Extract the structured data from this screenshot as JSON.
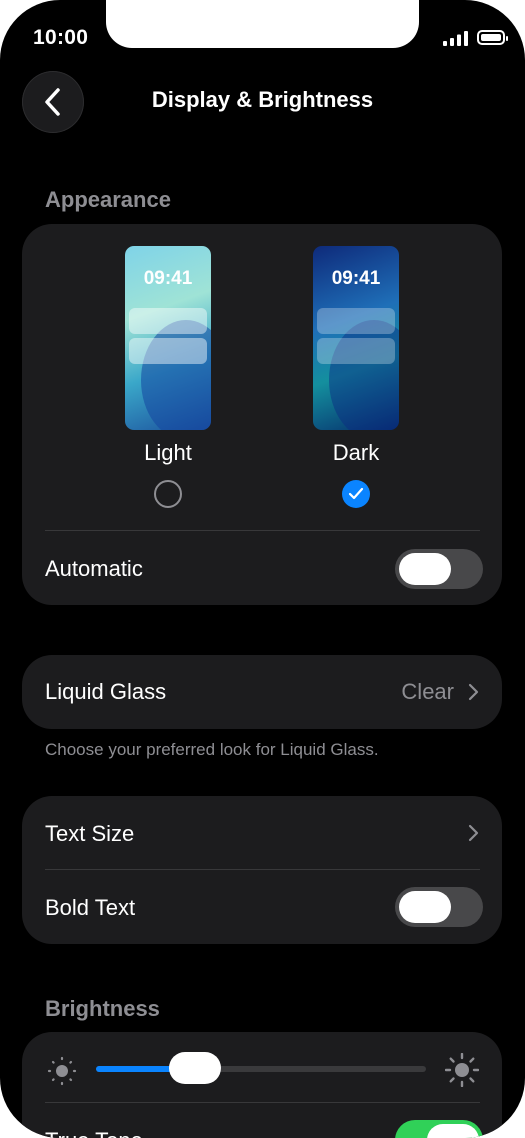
{
  "status_bar": {
    "time": "10:00"
  },
  "nav": {
    "title": "Display & Brightness"
  },
  "appearance": {
    "header": "Appearance",
    "options": [
      {
        "label": "Light",
        "preview_time": "09:41",
        "selected": false
      },
      {
        "label": "Dark",
        "preview_time": "09:41",
        "selected": true
      }
    ],
    "automatic_label": "Automatic",
    "automatic_on": false
  },
  "liquid_glass": {
    "label": "Liquid Glass",
    "value": "Clear",
    "footnote": "Choose your preferred look for Liquid Glass."
  },
  "text": {
    "text_size_label": "Text Size",
    "bold_text_label": "Bold Text",
    "bold_text_on": false
  },
  "brightness": {
    "header": "Brightness",
    "level": 0.3,
    "true_tone_label": "True Tone",
    "true_tone_on": true
  },
  "colors": {
    "accent": "#0a84ff",
    "toggle_on": "#30d158",
    "secondary_text": "#8e8e93"
  }
}
